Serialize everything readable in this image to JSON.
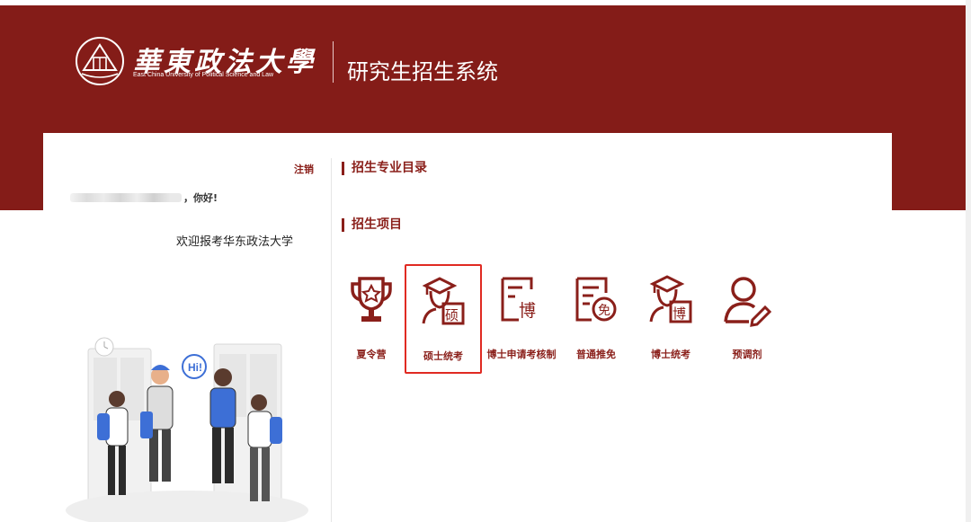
{
  "header": {
    "university_name_cn": "華東政法大學",
    "university_name_en": "East China University of Political Science and Law",
    "system_title": "研究生招生系统",
    "brand_color": "#841c18"
  },
  "user_panel": {
    "logout_label": "注销",
    "greeting_suffix": "，你好!",
    "welcome_text": "欢迎报考华东政法大学"
  },
  "sections": {
    "catalog_title": "招生专业目录",
    "projects_title": "招生项目"
  },
  "projects": [
    {
      "label": "夏令营",
      "icon": "trophy-icon",
      "selected": false
    },
    {
      "label": "硕士统考",
      "icon": "graduate-master-icon",
      "selected": true
    },
    {
      "label": "博士申请考核制",
      "icon": "document-doctor-icon",
      "selected": false
    },
    {
      "label": "普通推免",
      "icon": "document-exempt-icon",
      "selected": false
    },
    {
      "label": "博士统考",
      "icon": "graduate-doctor-icon",
      "selected": false
    },
    {
      "label": "预调剂",
      "icon": "user-edit-icon",
      "selected": false
    }
  ],
  "colors": {
    "accent": "#8a1f1a",
    "selection_border": "#e02a22"
  }
}
